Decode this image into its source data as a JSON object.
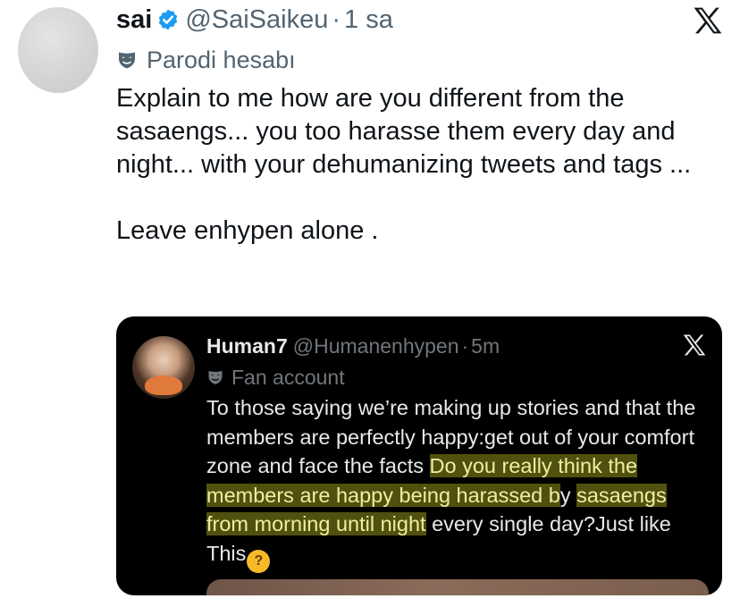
{
  "tweet": {
    "author_name": "sai",
    "handle": "@SaiSaikeu",
    "separator": "·",
    "time": "1 sa",
    "account_label": "Parodi hesabı",
    "text_line1": "Explain to me how are you different from the sasaengs... you too harasse them every day and night... with your dehumanizing tweets and tags ...",
    "text_line2": "Leave enhypen alone ."
  },
  "quoted_tweet": {
    "author_name": "Human7",
    "handle": "@Humanenhypen",
    "separator": "·",
    "time": "5m",
    "account_label": "Fan account",
    "text_plain": "To those saying we’re making up stories and that the members are perfectly happy:get out of your comfort zone and face the facts ",
    "text_highlight": "Do you really think the members are happy being harassed b",
    "text_mid": "y ",
    "text_highlight2": "sasaengs from morning until night",
    "text_end": " every single day?Just like This",
    "emoji": "thinking-face"
  },
  "icons": {
    "brand": "x-logo-icon",
    "verified": "verified-badge-icon",
    "label": "mask-icon"
  },
  "colors": {
    "verified_blue": "#1d9bf0",
    "highlight": "#51510f",
    "quote_background": "#000000"
  }
}
